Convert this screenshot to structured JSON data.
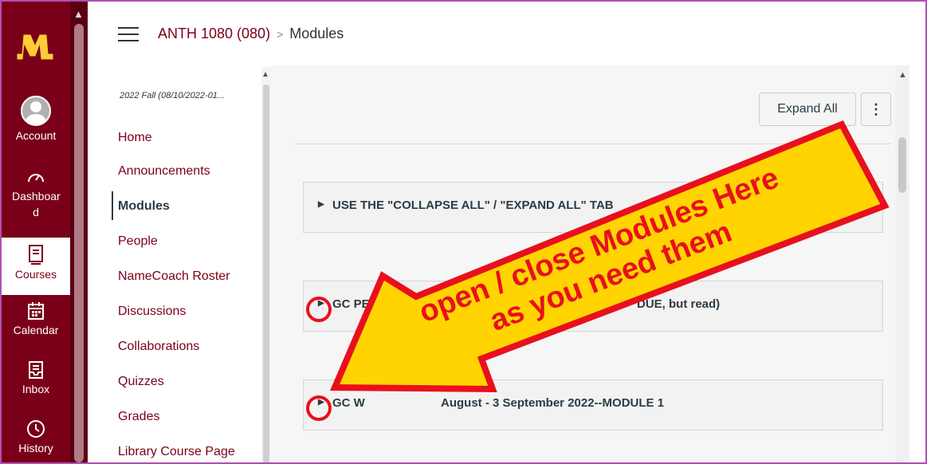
{
  "global_nav": {
    "items": [
      {
        "label": "Account",
        "icon": "account-avatar-icon"
      },
      {
        "label": "Dashboar d",
        "icon": "dashboard-icon"
      },
      {
        "label": "Courses",
        "icon": "courses-icon",
        "active": true
      },
      {
        "label": "Calendar",
        "icon": "calendar-icon"
      },
      {
        "label": "Inbox",
        "icon": "inbox-icon"
      },
      {
        "label": "History",
        "icon": "history-icon"
      }
    ],
    "brand_color": "#7a0019",
    "logo_accent": "#ffcc33"
  },
  "header": {
    "course": "ANTH 1080 (080)",
    "separator": ">",
    "page": "Modules"
  },
  "course_nav": {
    "term": "2022 Fall (08/10/2022-01...",
    "items": [
      "Home",
      "Announcements",
      "Modules",
      "People",
      "NameCoach Roster",
      "Discussions",
      "Collaborations",
      "Quizzes",
      "Grades",
      "Library Course Page"
    ],
    "active": "Modules"
  },
  "toolbar": {
    "expand_all": "Expand All",
    "more": "⋮"
  },
  "modules": [
    {
      "title": "USE THE \"COLLAPSE ALL\" / \"EXPAND ALL\" TAB",
      "trailing": "..."
    },
    {
      "title": "GC PERFORM",
      "trailing": "DUE, but read)"
    },
    {
      "title": "GC W",
      "trailing": "August - 3 September 2022--MODULE 1"
    }
  ],
  "annotation": {
    "line1": "open / close Modules Here",
    "line2": "as you need them",
    "arrow_color": "#ffd400",
    "outline_color": "#e8101c"
  }
}
